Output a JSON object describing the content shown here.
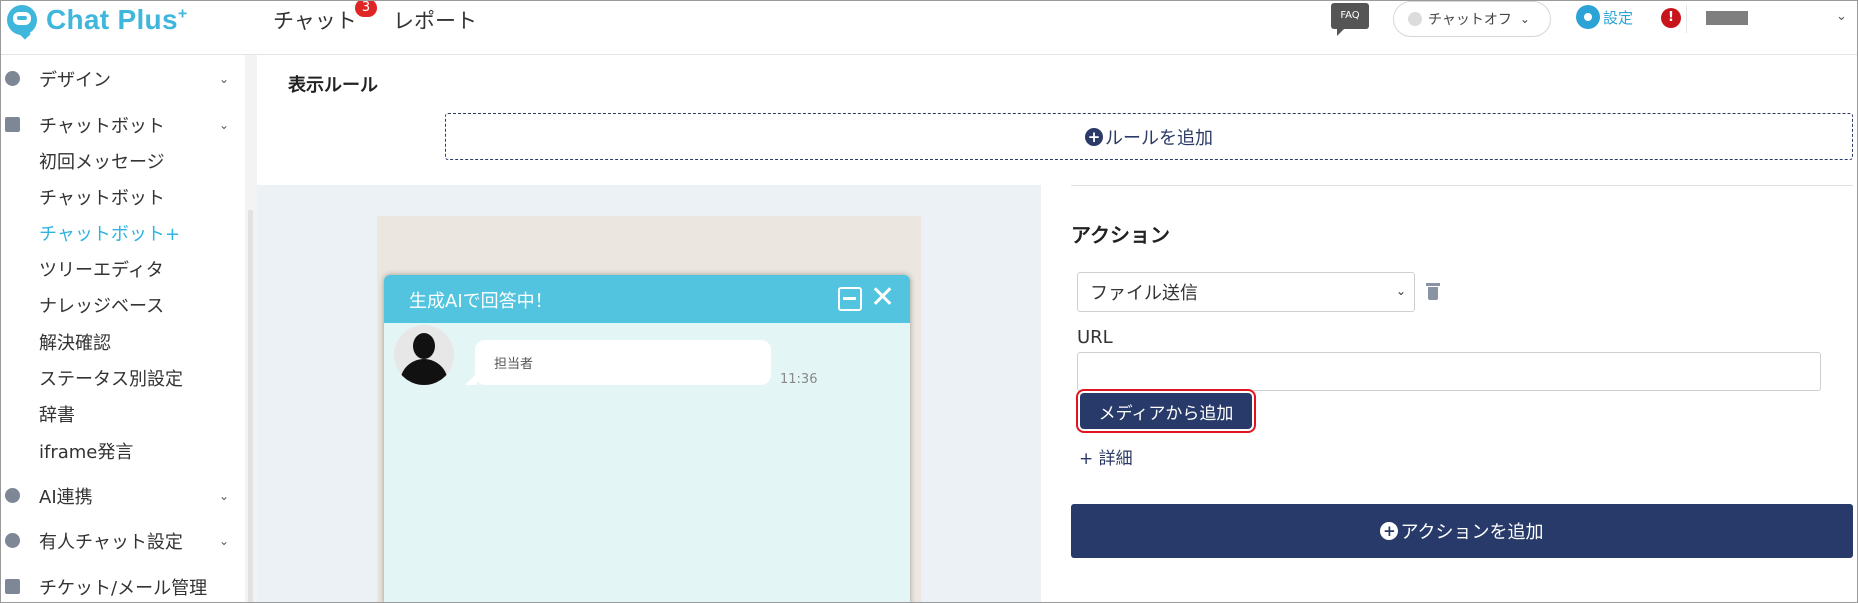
{
  "app": {
    "brand": "Chat Plus",
    "brand_sup": "+",
    "nav": {
      "chat": "チャット",
      "chat_badge": "3",
      "report": "レポート"
    },
    "faq": "FAQ",
    "chat_status": "チャットオフ",
    "settings": "設定",
    "alert": "!"
  },
  "sidebar": {
    "groups": [
      {
        "label": "デザイン",
        "icon": "palette-icon"
      },
      {
        "label": "チャットボット",
        "icon": "chat-bubbles-icon"
      },
      {
        "label": "AI連携",
        "icon": "bulb-icon"
      },
      {
        "label": "有人チャット設定",
        "icon": "operator-icon"
      },
      {
        "label": "チケット/メール管理",
        "icon": "ticket-icon"
      }
    ],
    "chatbot_items": [
      {
        "label": "初回メッセージ"
      },
      {
        "label": "チャットボット"
      },
      {
        "label": "チャットボット+",
        "active": true
      },
      {
        "label": "ツリーエディタ"
      },
      {
        "label": "ナレッジベース"
      },
      {
        "label": "解決確認"
      },
      {
        "label": "ステータス別設定"
      },
      {
        "label": "辞書"
      },
      {
        "label": "iframe発言"
      }
    ]
  },
  "main": {
    "display_rule_title": "表示ルール",
    "add_rule": "ルールを追加",
    "preview": {
      "chat_title": "生成AIで回答中！",
      "bubble_text": "担当者",
      "time": "11:36"
    },
    "action": {
      "title": "アクション",
      "select_value": "ファイル送信",
      "url_label": "URL",
      "url_value": "",
      "media_button": "メディアから追加",
      "detail_link": "+ 詳細",
      "add_action": "アクションを追加"
    }
  },
  "colors": {
    "brand": "#3fb6dc",
    "navy": "#273a6a",
    "highlight_border": "#e0151f",
    "chat_header": "#52c4df",
    "active_sidebar": "#2fb3e0"
  }
}
